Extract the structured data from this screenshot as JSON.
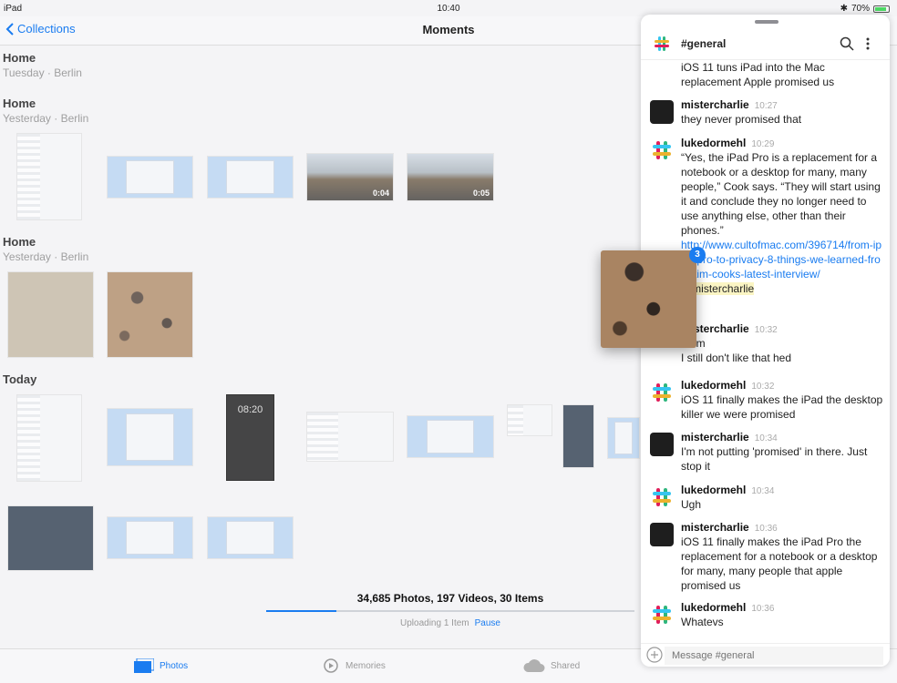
{
  "status": {
    "device": "iPad",
    "time": "10:40",
    "battery": "70%"
  },
  "nav": {
    "back_label": "Collections",
    "title": "Moments"
  },
  "moments": [
    {
      "title": "Home",
      "subtitle": "Tuesday · Berlin"
    },
    {
      "title": "Home",
      "subtitle": "Yesterday · Berlin"
    },
    {
      "title": "Home",
      "subtitle": "Yesterday · Berlin"
    },
    {
      "title": "Today",
      "subtitle": ""
    }
  ],
  "videos": {
    "duration_1": "0:04",
    "duration_2": "0:05"
  },
  "phone_lockscreen_time": "08:20",
  "library": {
    "counts": "34,685 Photos, 197 Videos, 30 Items",
    "upload_status": "Uploading 1 Item",
    "pause_label": "Pause",
    "upload_progress": 0.19
  },
  "tabs": {
    "photos": "Photos",
    "memories": "Memories",
    "shared": "Shared"
  },
  "slack": {
    "channel": "#general",
    "messages": [
      {
        "name": "",
        "time": "",
        "text": "iOS 11 tuns iPad into the Mac replacement Apple promised us"
      },
      {
        "name": "mistercharlie",
        "time": "10:27",
        "text": "they never promised that"
      },
      {
        "name": "lukedormehl",
        "time": "10:29",
        "text": "“Yes, the iPad Pro is a replacement for a notebook or a desktop for many, many people,” Cook says. “They will start using it and conclude they no longer need to use anything else, other than their phones.”",
        "link": "http://www.cultofmac.com/396714/from-ipad-pro-to-privacy-8-things-we-learned-from-tim-cooks-latest-interview/",
        "mention": "@mistercharlie"
      },
      {
        "name": "mistercharlie",
        "time": "10:32",
        "text": "hmm",
        "text2": "I still don't like that hed"
      },
      {
        "name": "lukedormehl",
        "time": "10:32",
        "text": "iOS 11 finally makes the iPad the desktop killer we were promised"
      },
      {
        "name": "mistercharlie",
        "time": "10:34",
        "text": "I'm not putting 'promised' in there. Just stop it"
      },
      {
        "name": "lukedormehl",
        "time": "10:34",
        "text": "Ugh"
      },
      {
        "name": "mistercharlie",
        "time": "10:36",
        "text": "iOS 11 finally makes the iPad Pro the replacement for a notebook or a desktop for many, many people that apple promised us"
      },
      {
        "name": "lukedormehl",
        "time": "10:36",
        "text": "Whatevs"
      }
    ],
    "composer_placeholder": "Message #general"
  },
  "drag_badge": "3"
}
